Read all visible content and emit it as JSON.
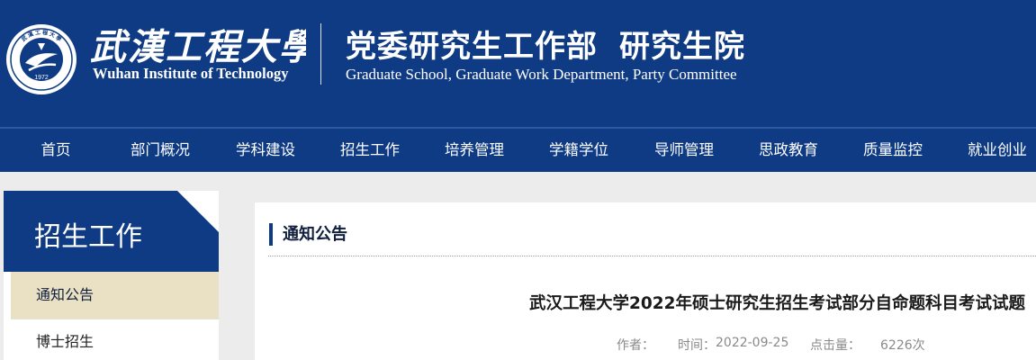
{
  "header": {
    "school_name_cn": "武漢工程大學",
    "school_name_en": "Wuhan Institute of Technology",
    "seal_year": "1972",
    "dept_title_part1": "党委研究生工作部",
    "dept_title_part2": "研究生院",
    "dept_subtitle": "Graduate School, Graduate Work Department, Party Committee",
    "brand_color": "#0f3b84"
  },
  "nav": {
    "items": [
      "首页",
      "部门概况",
      "学科建设",
      "招生工作",
      "培养管理",
      "学籍学位",
      "导师管理",
      "思政教育",
      "质量监控",
      "就业创业"
    ]
  },
  "sidebar": {
    "title": "招生工作",
    "items": [
      {
        "label": "通知公告",
        "active": true
      },
      {
        "label": "博士招生",
        "active": false
      }
    ],
    "active_color": "#eae1c5"
  },
  "content": {
    "section_title": "通知公告",
    "article_title": "武汉工程大学2022年硕士研究生招生考试部分自命题科目考试试题",
    "meta": {
      "author_label": "作者：",
      "time_label": "时间：",
      "time_value": "2022-09-25",
      "views_label": "点击量：",
      "views_value": "6226次"
    }
  }
}
